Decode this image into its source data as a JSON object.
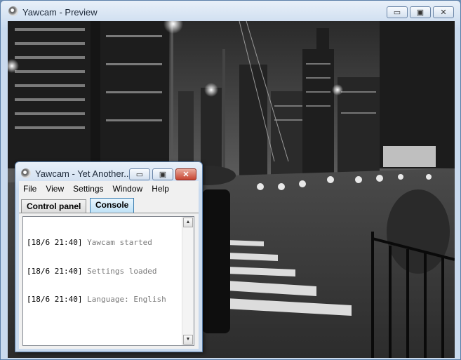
{
  "preview_window": {
    "title": "Yawcam - Preview",
    "controls": {
      "minimize": "▭",
      "maximize": "▣",
      "close": "✕"
    }
  },
  "console_window": {
    "title": "Yawcam - Yet Another...",
    "controls": {
      "minimize": "▭",
      "maximize": "▣",
      "close": "✕"
    },
    "menu": [
      "File",
      "View",
      "Settings",
      "Window",
      "Help"
    ],
    "tabs": [
      "Control panel",
      "Console"
    ],
    "active_tab": "Console",
    "log": [
      {
        "time": "[18/6 21:40]",
        "message": "Yawcam started"
      },
      {
        "time": "[18/6 21:40]",
        "message": "Settings loaded"
      },
      {
        "time": "[18/6 21:40]",
        "message": "Language: English"
      }
    ],
    "scroll_icons": {
      "up": "▲",
      "down": "▼"
    }
  },
  "colors": {
    "active_tab": "#bfe2f7",
    "close_button": "#c74532",
    "title_gradient": "#c9daee"
  }
}
